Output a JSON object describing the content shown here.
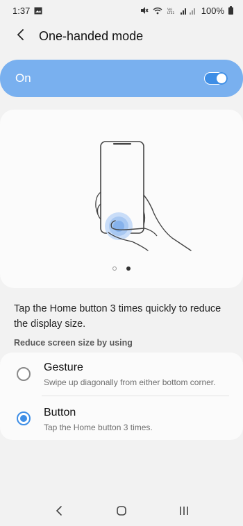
{
  "status_bar": {
    "time": "1:37",
    "battery": "100%",
    "icons": [
      "gallery-icon",
      "mute-icon",
      "wifi-icon",
      "volte-icon",
      "signal-icon",
      "battery-icon"
    ]
  },
  "header": {
    "title": "One-handed mode",
    "back_icon": "chevron-left-icon"
  },
  "master_switch": {
    "label": "On",
    "enabled": true
  },
  "illustration": {
    "page_count": 2,
    "active_page": 2
  },
  "description": "Tap the Home button 3 times quickly to reduce the display size.",
  "options_section": {
    "header": "Reduce screen size by using",
    "options": [
      {
        "title": "Gesture",
        "subtitle": "Swipe up diagonally from either bottom corner.",
        "selected": false
      },
      {
        "title": "Button",
        "subtitle": "Tap the Home button 3 times.",
        "selected": true
      }
    ]
  },
  "colors": {
    "accent": "#3e8ee6",
    "switch_bar": "#79b0ef",
    "background": "#f2f2f2",
    "card": "#fbfbfb"
  },
  "nav_bar": {
    "icons": [
      "back-icon",
      "home-icon",
      "recents-icon"
    ]
  }
}
